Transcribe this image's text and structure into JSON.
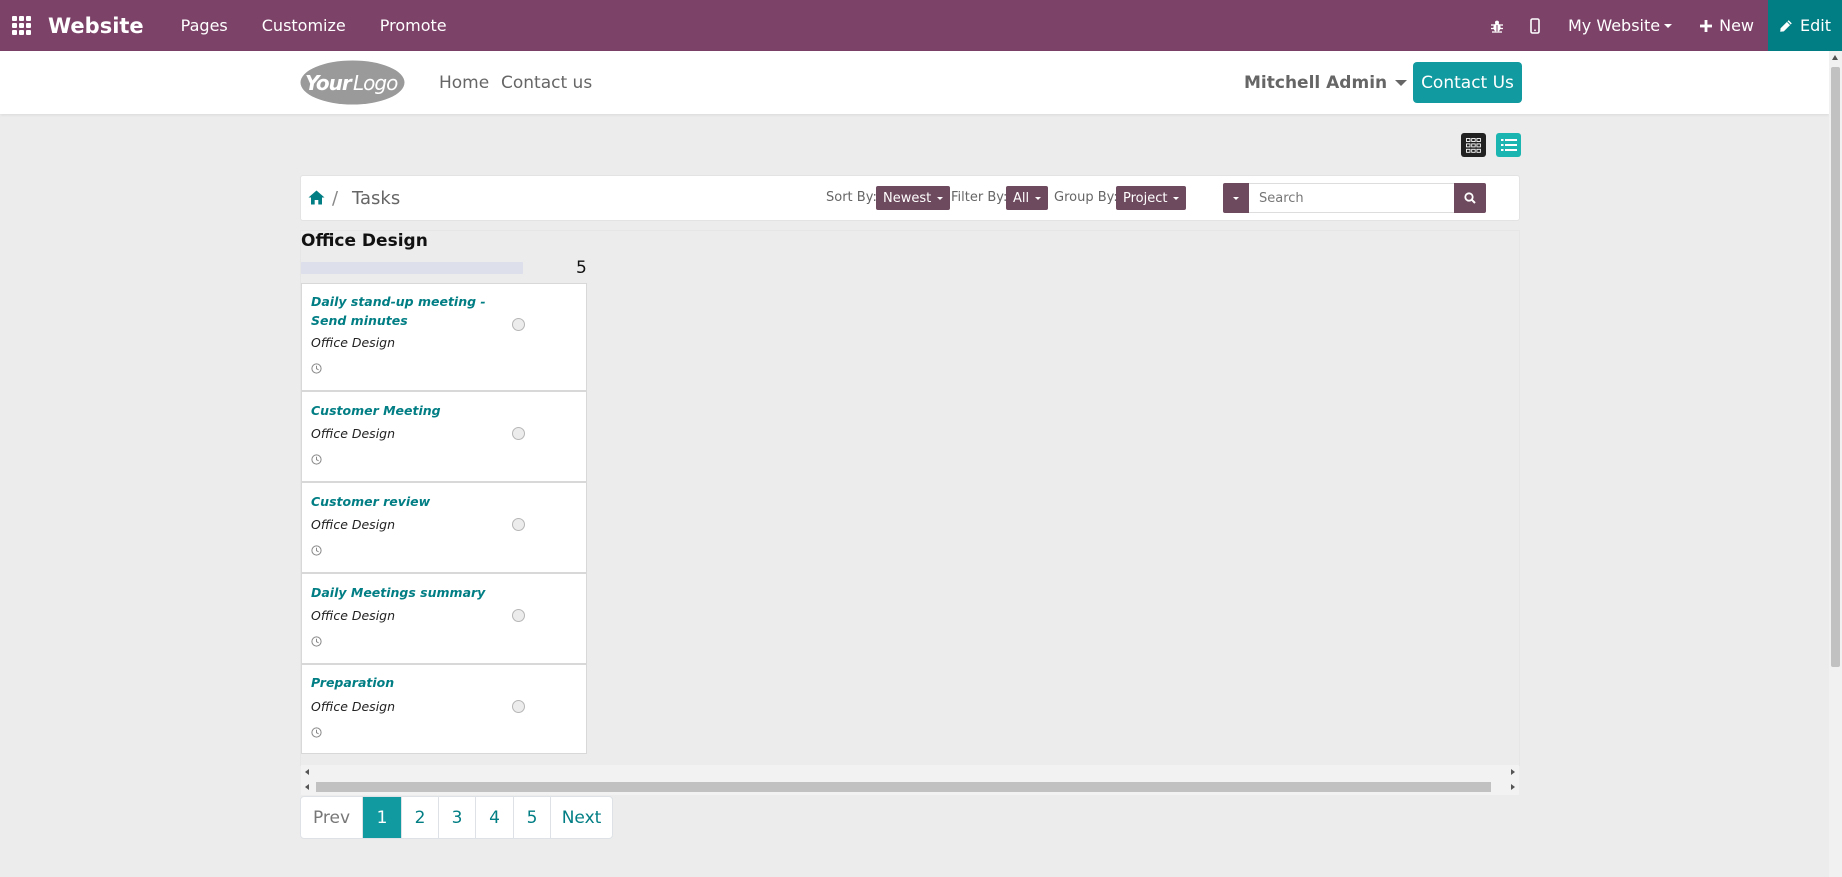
{
  "topbar": {
    "brand": "Website",
    "nav": [
      "Pages",
      "Customize",
      "Promote"
    ],
    "my_website": "My Website",
    "new_label": "New",
    "edit_label": "Edit",
    "color": "#7c4268",
    "edit_color": "#017e84"
  },
  "header": {
    "logo_text": "YourLogo",
    "nav": [
      "Home",
      "Contact us"
    ],
    "user": "Mitchell Admin",
    "contact_button": "Contact Us"
  },
  "toolbar": {
    "breadcrumb_current": "Tasks",
    "sort_label": "Sort By:",
    "sort_value": "Newest",
    "filter_label": "Filter By:",
    "filter_value": "All",
    "group_label": "Group By:",
    "group_value": "Project",
    "search_placeholder": "Search"
  },
  "kanban": {
    "column_title": "Office Design",
    "column_count": "5",
    "cards": [
      {
        "title": "Daily stand-up meeting - Send minutes",
        "project": "Office Design"
      },
      {
        "title": "Customer Meeting",
        "project": "Office Design"
      },
      {
        "title": "Customer review",
        "project": "Office Design"
      },
      {
        "title": "Daily Meetings summary",
        "project": "Office Design"
      },
      {
        "title": "Preparation",
        "project": "Office Design"
      }
    ]
  },
  "pager": {
    "prev": "Prev",
    "pages": [
      "1",
      "2",
      "3",
      "4",
      "5"
    ],
    "active_page": "1",
    "next": "Next"
  },
  "icons": {
    "apps": "apps-grid-icon",
    "debug": "bug-icon",
    "mobile": "mobile-icon",
    "new": "plus-icon",
    "edit": "pencil-icon",
    "home": "home-icon",
    "search": "search-icon",
    "clock": "clock-icon",
    "view_grid": "grid-view-icon",
    "view_list": "list-view-icon"
  }
}
